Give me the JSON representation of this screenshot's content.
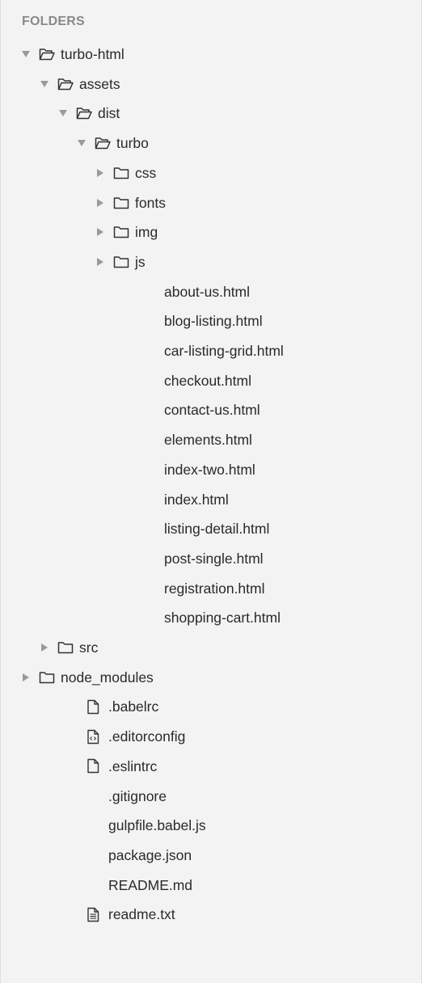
{
  "sidebar": {
    "header": "FOLDERS",
    "colors": {
      "background": "#f3f3f3",
      "text": "#2a2a2a",
      "header": "#8a8a8a",
      "arrow": "#9a9a9a",
      "icon": "#333333"
    },
    "items": [
      {
        "label": "turbo-html",
        "kind": "folder",
        "expanded": true,
        "depth": 0
      },
      {
        "label": "assets",
        "kind": "folder",
        "expanded": true,
        "depth": 1
      },
      {
        "label": "dist",
        "kind": "folder",
        "expanded": true,
        "depth": 2
      },
      {
        "label": "turbo",
        "kind": "folder",
        "expanded": true,
        "depth": 3
      },
      {
        "label": "css",
        "kind": "folder",
        "expanded": false,
        "depth": 4
      },
      {
        "label": "fonts",
        "kind": "folder",
        "expanded": false,
        "depth": 4
      },
      {
        "label": "img",
        "kind": "folder",
        "expanded": false,
        "depth": 4
      },
      {
        "label": "js",
        "kind": "folder",
        "expanded": false,
        "depth": 4
      },
      {
        "label": "about-us.html",
        "kind": "file",
        "icon": "none",
        "depth": 4
      },
      {
        "label": "blog-listing.html",
        "kind": "file",
        "icon": "none",
        "depth": 4
      },
      {
        "label": "car-listing-grid.html",
        "kind": "file",
        "icon": "none",
        "depth": 4
      },
      {
        "label": "checkout.html",
        "kind": "file",
        "icon": "none",
        "depth": 4
      },
      {
        "label": "contact-us.html",
        "kind": "file",
        "icon": "none",
        "depth": 4
      },
      {
        "label": "elements.html",
        "kind": "file",
        "icon": "none",
        "depth": 4
      },
      {
        "label": "index-two.html",
        "kind": "file",
        "icon": "none",
        "depth": 4
      },
      {
        "label": "index.html",
        "kind": "file",
        "icon": "none",
        "depth": 4
      },
      {
        "label": "listing-detail.html",
        "kind": "file",
        "icon": "none",
        "depth": 4
      },
      {
        "label": "post-single.html",
        "kind": "file",
        "icon": "none",
        "depth": 4
      },
      {
        "label": "registration.html",
        "kind": "file",
        "icon": "none",
        "depth": 4
      },
      {
        "label": "shopping-cart.html",
        "kind": "file",
        "icon": "none",
        "depth": 4
      },
      {
        "label": "src",
        "kind": "folder",
        "expanded": false,
        "depth": 1
      },
      {
        "label": "node_modules",
        "kind": "folder",
        "expanded": false,
        "depth": 0
      },
      {
        "label": ".babelrc",
        "kind": "file",
        "icon": "file-icon",
        "depth": 1
      },
      {
        "label": ".editorconfig",
        "kind": "file",
        "icon": "code-file-icon",
        "depth": 1
      },
      {
        "label": ".eslintrc",
        "kind": "file",
        "icon": "file-icon",
        "depth": 1
      },
      {
        "label": ".gitignore",
        "kind": "file",
        "icon": "none",
        "depth": 1
      },
      {
        "label": "gulpfile.babel.js",
        "kind": "file",
        "icon": "none",
        "depth": 1
      },
      {
        "label": "package.json",
        "kind": "file",
        "icon": "none",
        "depth": 1
      },
      {
        "label": "README.md",
        "kind": "file",
        "icon": "none",
        "depth": 1
      },
      {
        "label": "readme.txt",
        "kind": "file",
        "icon": "text-file-icon",
        "depth": 1
      }
    ]
  }
}
